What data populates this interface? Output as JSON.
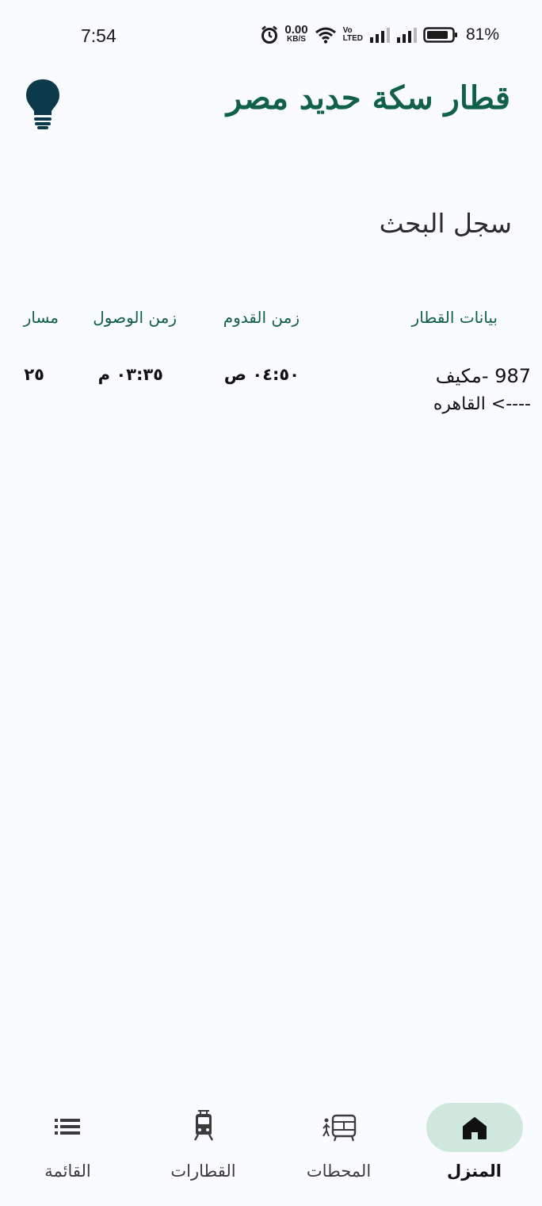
{
  "status_bar": {
    "time": "7:54",
    "net_speed_value": "0.00",
    "net_speed_unit": "KB/S",
    "volte_top": "Vo",
    "volte_bottom": "LTED",
    "battery_percent": "81%",
    "icons": [
      "alarm-icon",
      "wifi-icon",
      "signal-icon",
      "signal-icon",
      "battery-icon"
    ]
  },
  "header": {
    "title": "قطار سكة حديد مصر",
    "theme_icon": "lightbulb-icon"
  },
  "history": {
    "title": "سجل البحث",
    "columns": {
      "train_info": "بيانات القطار",
      "departure": "زمن القدوم",
      "arrival": "زمن الوصول",
      "platform": "مسار"
    },
    "rows": [
      {
        "train": "987 -مكيف",
        "destination": "----> القاهره",
        "departure": "٠٤:٥٠ ص",
        "arrival": "٠٣:٣٥ م",
        "platform": "٢٥"
      }
    ]
  },
  "nav": {
    "items": [
      {
        "label": "المنزل",
        "icon": "home-icon",
        "active": true
      },
      {
        "label": "المحطات",
        "icon": "station-icon",
        "active": false
      },
      {
        "label": "القطارات",
        "icon": "train-icon",
        "active": false
      },
      {
        "label": "القائمة",
        "icon": "list-icon",
        "active": false
      }
    ]
  },
  "colors": {
    "accent": "#116149",
    "active_pill": "#cfe8dd",
    "background": "#f9fbfe",
    "bulb": "#0d3a4a"
  }
}
